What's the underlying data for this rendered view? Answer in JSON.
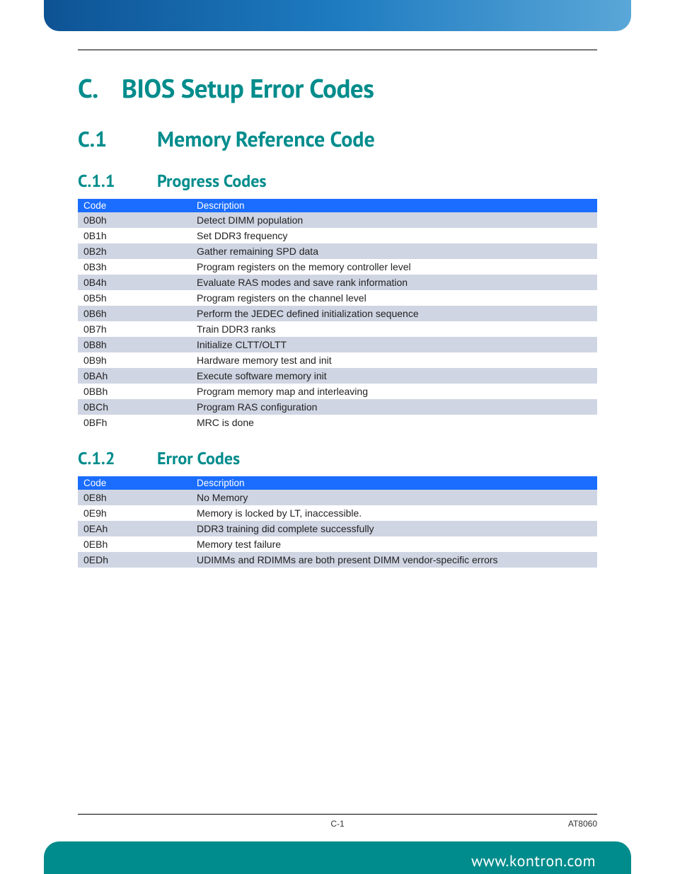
{
  "headings": {
    "h1_num": "C.",
    "h1_title": "BIOS Setup Error Codes",
    "h2_num": "C.1",
    "h2_title": "Memory Reference Code",
    "h3a_num": "C.1.1",
    "h3a_title": "Progress Codes",
    "h3b_num": "C.1.2",
    "h3b_title": "Error Codes"
  },
  "table_headers": {
    "code": "Code",
    "description": "Description"
  },
  "progress_codes": [
    {
      "code": "0B0h",
      "desc": "Detect DIMM population"
    },
    {
      "code": "0B1h",
      "desc": "Set DDR3 frequency"
    },
    {
      "code": "0B2h",
      "desc": "Gather remaining SPD data"
    },
    {
      "code": "0B3h",
      "desc": "Program registers on the memory controller level"
    },
    {
      "code": "0B4h",
      "desc": "Evaluate RAS modes and save rank information"
    },
    {
      "code": "0B5h",
      "desc": "Program registers on the channel level"
    },
    {
      "code": "0B6h",
      "desc": "Perform the JEDEC defined initialization sequence"
    },
    {
      "code": "0B7h",
      "desc": "Train DDR3 ranks"
    },
    {
      "code": "0B8h",
      "desc": "Initialize CLTT/OLTT"
    },
    {
      "code": "0B9h",
      "desc": "Hardware memory test and init"
    },
    {
      "code": "0BAh",
      "desc": "Execute software memory init"
    },
    {
      "code": "0BBh",
      "desc": "Program memory map and interleaving"
    },
    {
      "code": "0BCh",
      "desc": "Program RAS configuration"
    },
    {
      "code": "0BFh",
      "desc": "MRC is done"
    }
  ],
  "error_codes": [
    {
      "code": "0E8h",
      "desc": "No Memory"
    },
    {
      "code": "0E9h",
      "desc": "Memory is locked by LT, inaccessible."
    },
    {
      "code": "0EAh",
      "desc": "DDR3 training did complete successfully"
    },
    {
      "code": "0EBh",
      "desc": "Memory test failure"
    },
    {
      "code": "0EDh",
      "desc": "UDIMMs and RDIMMs are both present DIMM vendor-specific errors"
    }
  ],
  "footer": {
    "page": "C-1",
    "doc": "AT8060",
    "url": "www.kontron.com"
  }
}
